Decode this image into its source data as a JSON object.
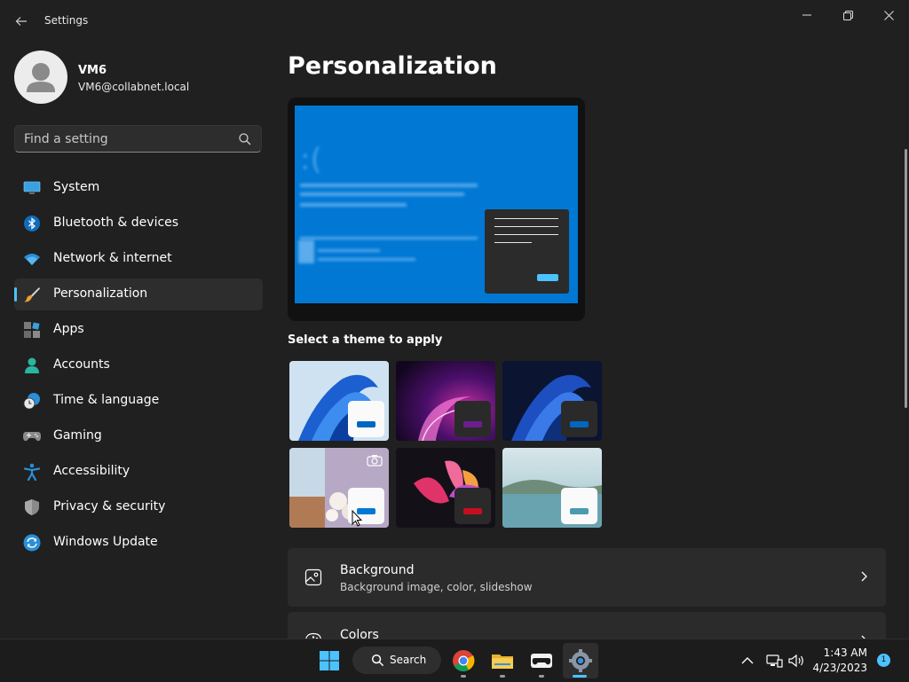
{
  "window": {
    "title": "Settings",
    "back_icon": "back-arrow-icon",
    "controls": [
      "minimize-icon",
      "restore-icon",
      "close-icon"
    ]
  },
  "user": {
    "name": "VM6",
    "email": "VM6@collabnet.local",
    "avatar_icon": "user-avatar-icon"
  },
  "search": {
    "placeholder": "Find a setting",
    "value": "",
    "icon": "search-icon"
  },
  "nav": {
    "items": [
      {
        "label": "System",
        "icon": "system-icon"
      },
      {
        "label": "Bluetooth & devices",
        "icon": "bluetooth-icon"
      },
      {
        "label": "Network & internet",
        "icon": "wifi-icon"
      },
      {
        "label": "Personalization",
        "icon": "brush-icon",
        "selected": true
      },
      {
        "label": "Apps",
        "icon": "apps-icon"
      },
      {
        "label": "Accounts",
        "icon": "accounts-icon"
      },
      {
        "label": "Time & language",
        "icon": "time-language-icon"
      },
      {
        "label": "Gaming",
        "icon": "gamepad-icon"
      },
      {
        "label": "Accessibility",
        "icon": "accessibility-icon"
      },
      {
        "label": "Privacy & security",
        "icon": "shield-icon"
      },
      {
        "label": "Windows Update",
        "icon": "update-icon"
      }
    ],
    "accent_color": "#4cc2ff"
  },
  "main": {
    "title": "Personalization",
    "theme_section_label": "Select a theme to apply",
    "themes": [
      {
        "name": "windows-light",
        "accent": "#0067c0"
      },
      {
        "name": "glow",
        "accent": "#6b1e8f"
      },
      {
        "name": "windows-dark",
        "accent": "#0067c0"
      },
      {
        "name": "captured-motion",
        "accent": "#0078d4",
        "has_spotlight_icon": true
      },
      {
        "name": "flow",
        "accent": "#c50f1f"
      },
      {
        "name": "sunrise",
        "accent": "#4a9bb0"
      }
    ],
    "cards": [
      {
        "title": "Background",
        "subtitle": "Background image, color, slideshow",
        "icon": "image-icon"
      },
      {
        "title": "Colors",
        "subtitle": "",
        "icon": "palette-icon"
      }
    ]
  },
  "taskbar": {
    "search_label": "Search",
    "apps": [
      "start-icon",
      "chrome-icon",
      "file-explorer-icon",
      "game-controller-icon",
      "settings-gear-icon"
    ],
    "tray": [
      "chevron-up-icon",
      "network-icon",
      "volume-icon"
    ],
    "time": "1:43 AM",
    "date": "4/23/2023",
    "notification_count": "1"
  }
}
